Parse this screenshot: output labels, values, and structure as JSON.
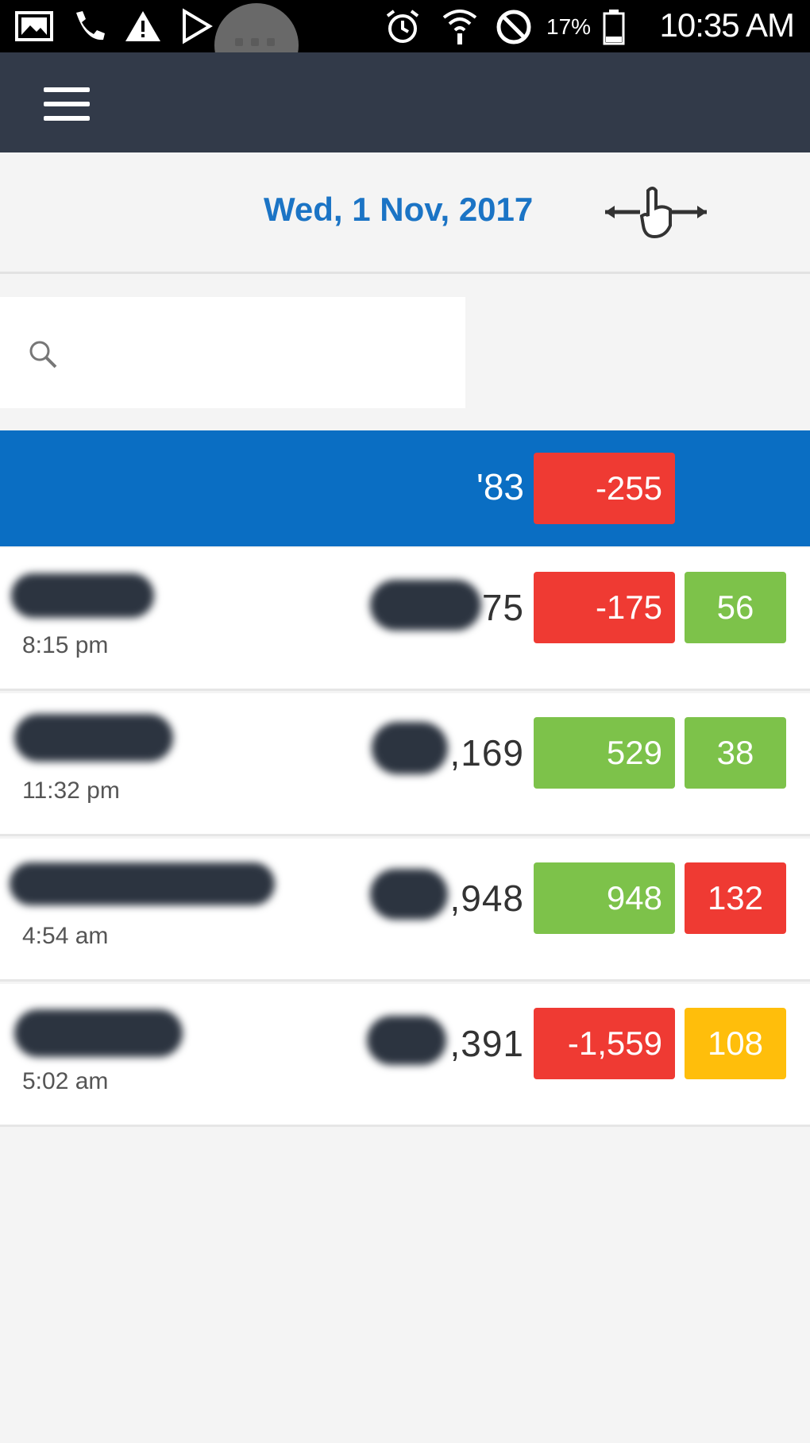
{
  "status_bar": {
    "time": "10:35 AM",
    "battery_percent": "17%",
    "icons": [
      "gallery-icon",
      "phone-icon",
      "warning-icon",
      "play-store-icon",
      "alarm-icon",
      "wifi-icon",
      "do-not-disturb-icon",
      "battery-icon"
    ]
  },
  "app_bar": {
    "menu_icon": "hamburger-menu-icon"
  },
  "date_nav": {
    "date": "Wed, 1 Nov, 2017",
    "swipe_icon": "swipe-left-right-hand-icon"
  },
  "search": {
    "icon": "search-icon",
    "placeholder": "",
    "value": ""
  },
  "summary": {
    "value": "'83",
    "diff": "-255",
    "diff_color": "#ef3a33"
  },
  "rows": [
    {
      "time": "8:15 pm",
      "value": "75",
      "diff": "-175",
      "diff_color": "#ef3a33",
      "count": "56",
      "count_color": "#7dc24a"
    },
    {
      "time": "11:32 pm",
      "value": ",169",
      "diff": "529",
      "diff_color": "#7dc24a",
      "count": "38",
      "count_color": "#7dc24a"
    },
    {
      "time": "4:54 am",
      "value": ",948",
      "diff": "948",
      "diff_color": "#7dc24a",
      "count": "132",
      "count_color": "#ef3a33"
    },
    {
      "time": "5:02 am",
      "value": ",391",
      "diff": "-1,559",
      "diff_color": "#ef3a33",
      "count": "108",
      "count_color": "#ffbe0b"
    }
  ]
}
